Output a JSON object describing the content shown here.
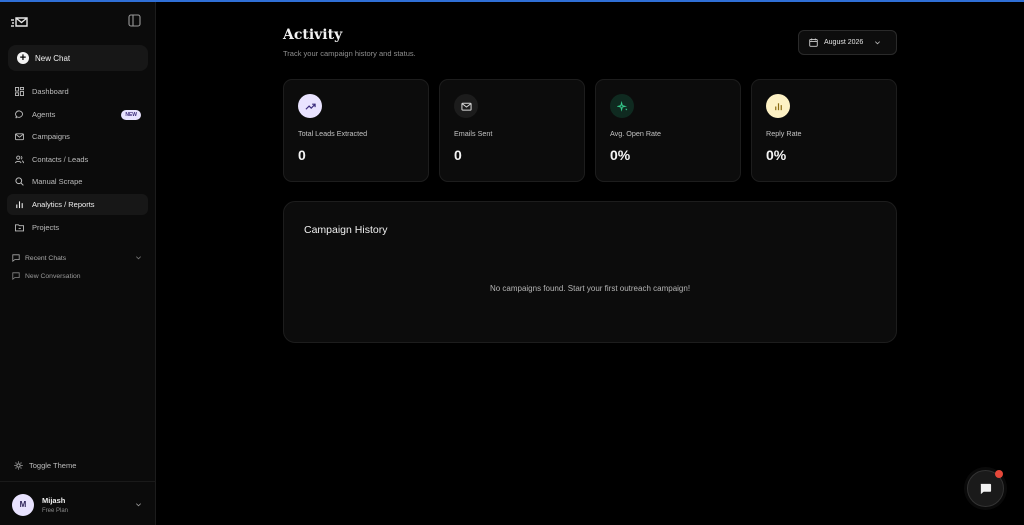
{
  "sidebar": {
    "new_chat_label": "New Chat",
    "items": [
      {
        "label": "Dashboard",
        "icon": "dashboard-icon"
      },
      {
        "label": "Agents",
        "icon": "chat-bubble-icon",
        "badge": "NEW"
      },
      {
        "label": "Campaigns",
        "icon": "mail-icon"
      },
      {
        "label": "Contacts / Leads",
        "icon": "users-icon"
      },
      {
        "label": "Manual Scrape",
        "icon": "search-icon"
      },
      {
        "label": "Analytics / Reports",
        "icon": "bar-chart-icon",
        "active": true
      },
      {
        "label": "Projects",
        "icon": "folder-icon"
      }
    ],
    "recent_chats_label": "Recent Chats",
    "recent_chats": [
      "New Conversation"
    ],
    "toggle_theme_label": "Toggle Theme",
    "user": {
      "initial": "M",
      "name": "Mijash",
      "plan": "Free Plan"
    }
  },
  "header": {
    "title": "Activity",
    "subtitle": "Track your campaign history and status.",
    "date_filter": "August 2026"
  },
  "stats": [
    {
      "label": "Total Leads Extracted",
      "value": "0",
      "icon": "trending-up-icon",
      "icon_bg": "#e9e3ff"
    },
    {
      "label": "Emails Sent",
      "value": "0",
      "icon": "mail-icon",
      "icon_bg": "#1c1c1c"
    },
    {
      "label": "Avg. Open Rate",
      "value": "0%",
      "icon": "sparkle-icon",
      "icon_bg": "#0f2a20"
    },
    {
      "label": "Reply Rate",
      "value": "0%",
      "icon": "bar-chart-icon",
      "icon_bg": "#fdf1c4"
    }
  ],
  "history": {
    "title": "Campaign History",
    "empty_message": "No campaigns found. Start your first outreach campaign!"
  },
  "colors": {
    "accent_top": "#2f6fd6",
    "badge_bg": "#e9e3ff",
    "notification_dot": "#e5483a"
  }
}
